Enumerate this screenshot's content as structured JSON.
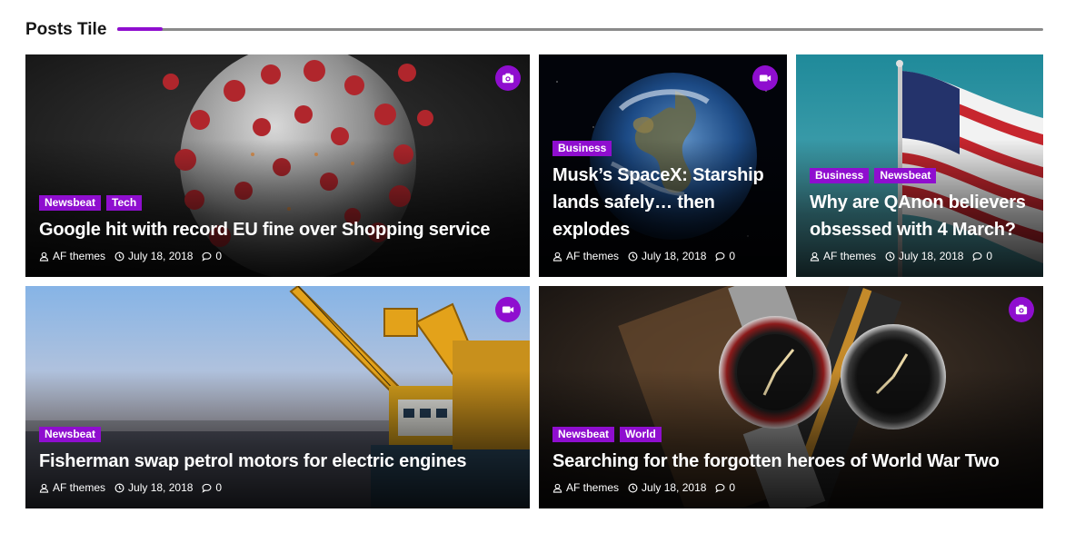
{
  "section": {
    "title": "Posts Tile"
  },
  "colors": {
    "accent": "#8f0ecf",
    "rule": "#8a8a8a"
  },
  "posts": [
    {
      "title": "Google hit with record EU fine over Shopping service",
      "categories": [
        "Newsbeat",
        "Tech"
      ],
      "author": "AF themes",
      "date": "July 18, 2018",
      "comments": "0",
      "format_icon": "camera-icon",
      "image": "coronavirus-image"
    },
    {
      "title": "Musk’s SpaceX: Starship lands safely… then explodes",
      "categories": [
        "Business"
      ],
      "author": "AF themes",
      "date": "July 18, 2018",
      "comments": "0",
      "format_icon": "video-icon",
      "image": "earth-image"
    },
    {
      "title": "Why are QAnon believers obsessed with 4 March?",
      "categories": [
        "Business",
        "Newsbeat"
      ],
      "author": "AF themes",
      "date": "July 18, 2018",
      "comments": "0",
      "format_icon": "",
      "image": "flag-image"
    },
    {
      "title": "Fisherman swap petrol motors for electric engines",
      "categories": [
        "Newsbeat"
      ],
      "author": "AF themes",
      "date": "July 18, 2018",
      "comments": "0",
      "format_icon": "video-icon",
      "image": "crane-ship-image"
    },
    {
      "title": "Searching for the forgotten heroes of World War Two",
      "categories": [
        "Newsbeat",
        "World"
      ],
      "author": "AF themes",
      "date": "July 18, 2018",
      "comments": "0",
      "format_icon": "camera-icon",
      "image": "watches-image"
    }
  ]
}
